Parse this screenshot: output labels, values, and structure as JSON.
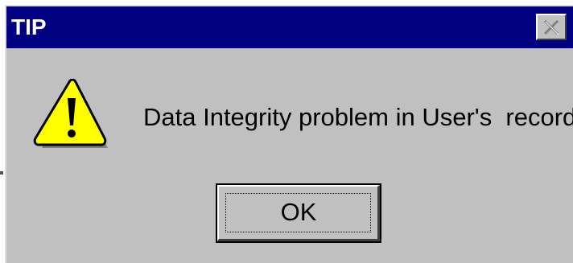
{
  "dialog": {
    "title": "TIP",
    "message": "Data Integrity problem in User's  record",
    "ok_label": "OK",
    "close_icon": "close-icon",
    "warning_icon": "warning-icon"
  },
  "colors": {
    "titlebar": "#000080",
    "title_text": "#ffffff",
    "window_bg": "#c0c0c0",
    "warning_fill": "#ffff00"
  }
}
